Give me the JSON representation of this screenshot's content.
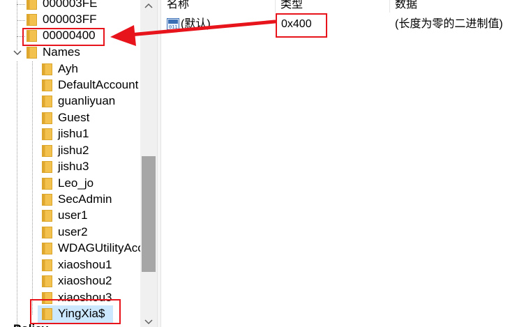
{
  "tree": {
    "items": [
      {
        "label": "000003FE"
      },
      {
        "label": "000003FF"
      },
      {
        "label": "00000400"
      },
      {
        "label": "Names"
      },
      {
        "label": "Ayh"
      },
      {
        "label": "DefaultAccount"
      },
      {
        "label": "guanliyuan"
      },
      {
        "label": "Guest"
      },
      {
        "label": "jishu1"
      },
      {
        "label": "jishu2"
      },
      {
        "label": "jishu3"
      },
      {
        "label": "Leo_jo"
      },
      {
        "label": "SecAdmin"
      },
      {
        "label": "user1"
      },
      {
        "label": "user2"
      },
      {
        "label": "WDAGUtilityAccount"
      },
      {
        "label": "xiaoshou1"
      },
      {
        "label": "xiaoshou2"
      },
      {
        "label": "xiaoshou3"
      },
      {
        "label": "YingXia$"
      },
      {
        "label": "Policy"
      }
    ],
    "selected": "YingXia$"
  },
  "values": {
    "headers": {
      "name": "名称",
      "type": "类型",
      "data": "数据"
    },
    "rows": [
      {
        "name": "(默认)",
        "type": "0x400",
        "data": "(长度为零的二进制值)",
        "icon": "binary-value-icon"
      }
    ]
  },
  "colors": {
    "annotation": "#e8141c",
    "selection": "#cce8ff",
    "folder": "#f2c14e",
    "scroll_thumb": "#a6a6a6"
  },
  "icons": {
    "folder": "folder-icon",
    "expander_open": "chevron-down-icon",
    "value": "binary-value-icon"
  }
}
